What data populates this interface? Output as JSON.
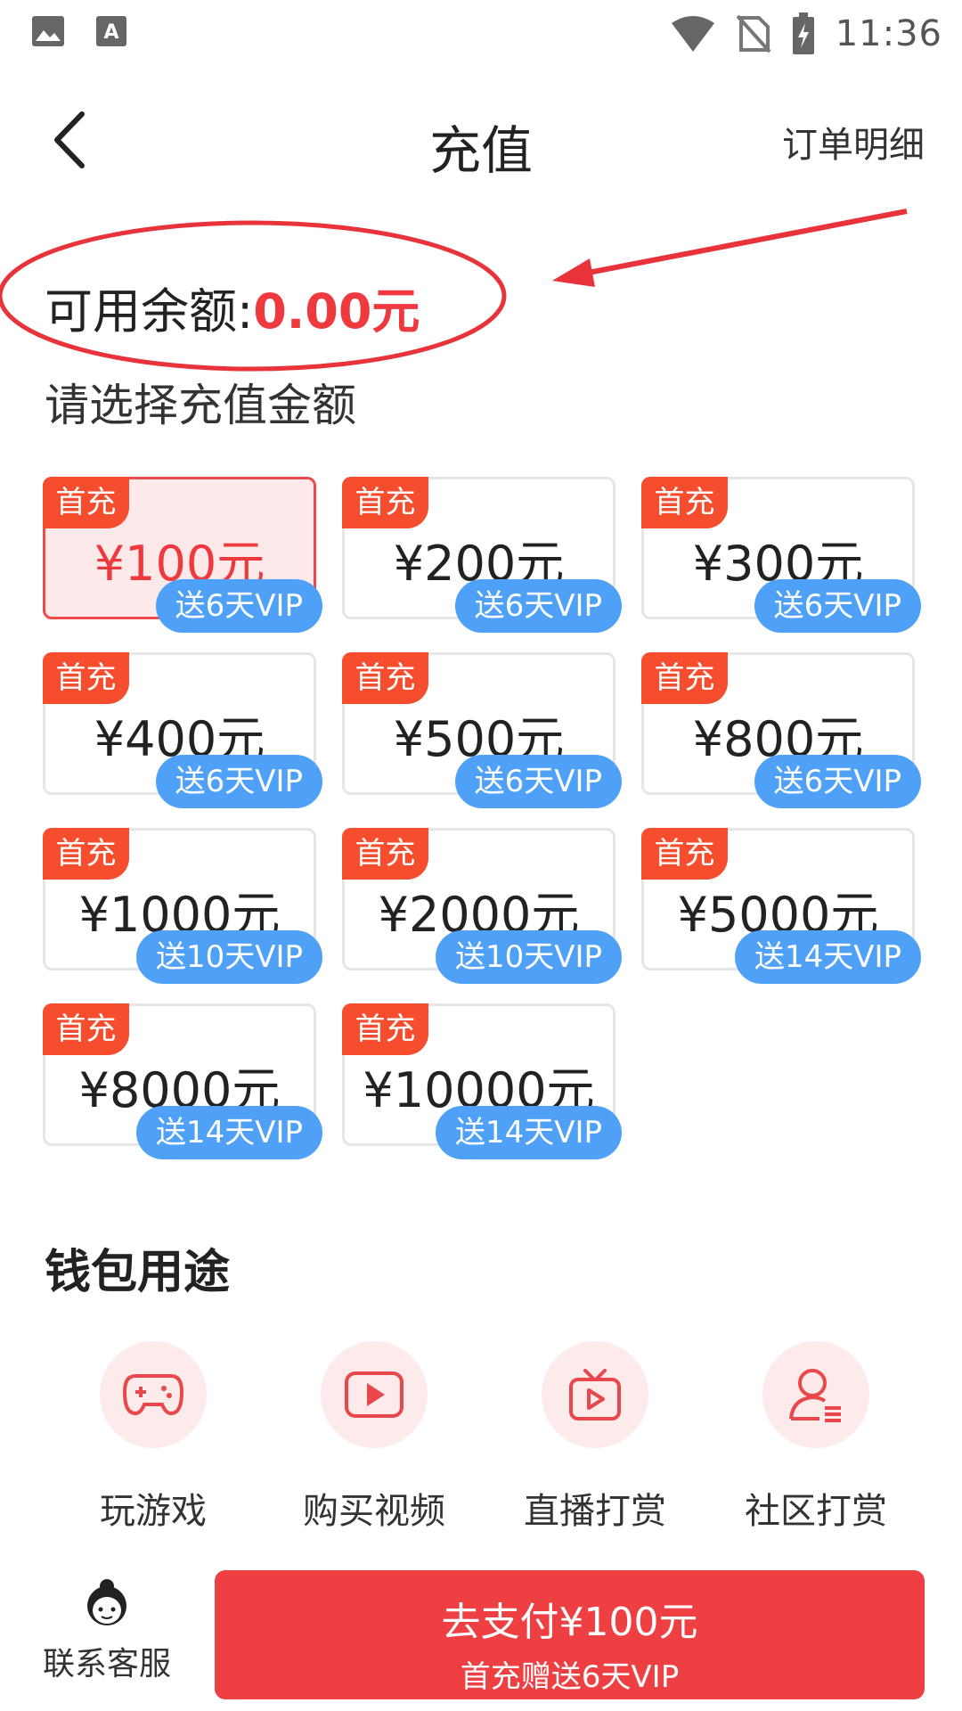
{
  "status_bar": {
    "time": "11:36",
    "left_icons": [
      "image-icon",
      "font-a-icon"
    ],
    "right_icons": [
      "wifi-icon",
      "no-sim-icon",
      "battery-charging-icon"
    ]
  },
  "header": {
    "title": "充值",
    "order_detail": "订单明细"
  },
  "balance": {
    "label": "可用余额:",
    "value": "0.00元"
  },
  "select_label": "请选择充值金额",
  "options": [
    {
      "tag": "首充",
      "price": "¥100元",
      "vip": "送6天VIP",
      "selected": true
    },
    {
      "tag": "首充",
      "price": "¥200元",
      "vip": "送6天VIP",
      "selected": false
    },
    {
      "tag": "首充",
      "price": "¥300元",
      "vip": "送6天VIP",
      "selected": false
    },
    {
      "tag": "首充",
      "price": "¥400元",
      "vip": "送6天VIP",
      "selected": false
    },
    {
      "tag": "首充",
      "price": "¥500元",
      "vip": "送6天VIP",
      "selected": false
    },
    {
      "tag": "首充",
      "price": "¥800元",
      "vip": "送6天VIP",
      "selected": false
    },
    {
      "tag": "首充",
      "price": "¥1000元",
      "vip": "送10天VIP",
      "selected": false
    },
    {
      "tag": "首充",
      "price": "¥2000元",
      "vip": "送10天VIP",
      "selected": false
    },
    {
      "tag": "首充",
      "price": "¥5000元",
      "vip": "送14天VIP",
      "selected": false
    },
    {
      "tag": "首充",
      "price": "¥8000元",
      "vip": "送14天VIP",
      "selected": false
    },
    {
      "tag": "首充",
      "price": "¥10000元",
      "vip": "送14天VIP",
      "selected": false
    }
  ],
  "wallet_uses": {
    "title": "钱包用途",
    "items": [
      {
        "label": "玩游戏",
        "icon": "gamepad-icon"
      },
      {
        "label": "购买视频",
        "icon": "play-video-icon"
      },
      {
        "label": "直播打赏",
        "icon": "tv-live-icon"
      },
      {
        "label": "社区打赏",
        "icon": "user-community-icon"
      }
    ]
  },
  "bottom": {
    "contact_label": "联系客服",
    "pay_main": "去支付¥100元",
    "pay_sub": "首充赠送6天VIP"
  },
  "colors": {
    "accent_red": "#ee3a3e",
    "tag_orange": "#f54d2d",
    "vip_blue": "#4fa0f7",
    "use_circle_bg": "#fdeaea"
  }
}
